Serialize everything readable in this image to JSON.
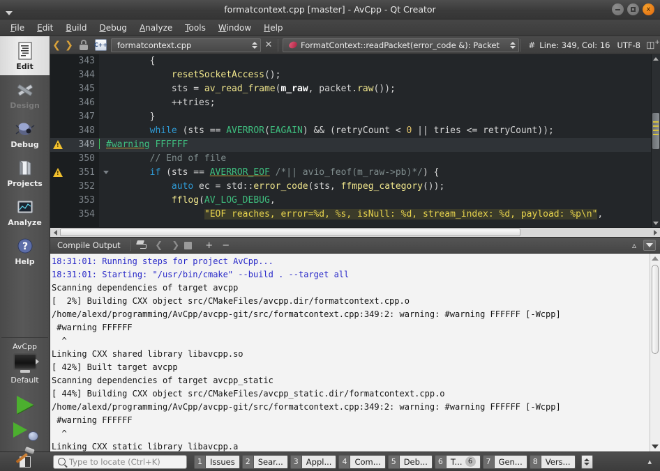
{
  "window": {
    "title": "formatcontext.cpp [master] - AvCpp - Qt Creator",
    "menu_arrow_icon": "triangle-down-icon",
    "buttons": {
      "minimize": "minimize-icon",
      "maximize": "maximize-icon",
      "close": "x"
    }
  },
  "menubar": {
    "items": [
      {
        "label": "File",
        "mnemonic": "F"
      },
      {
        "label": "Edit",
        "mnemonic": "E"
      },
      {
        "label": "Build",
        "mnemonic": "B"
      },
      {
        "label": "Debug",
        "mnemonic": "D"
      },
      {
        "label": "Analyze",
        "mnemonic": "A"
      },
      {
        "label": "Tools",
        "mnemonic": "T"
      },
      {
        "label": "Window",
        "mnemonic": "W"
      },
      {
        "label": "Help",
        "mnemonic": "H"
      }
    ]
  },
  "modebar": {
    "items": [
      {
        "label": "Edit",
        "icon": "document-lines-icon",
        "state": "active"
      },
      {
        "label": "Design",
        "icon": "ruler-pen-icon",
        "state": "disabled"
      },
      {
        "label": "Debug",
        "icon": "bug-icon",
        "state": "normal"
      },
      {
        "label": "Projects",
        "icon": "folder-icon",
        "state": "normal"
      },
      {
        "label": "Analyze",
        "icon": "monitor-graph-icon",
        "state": "normal"
      },
      {
        "label": "Help",
        "icon": "question-circle-icon",
        "state": "normal"
      }
    ],
    "kit": {
      "project": "AvCpp",
      "configuration": "Default",
      "target_icon": "desktop-monitor-icon",
      "expand_icon": "triangle-right-icon"
    },
    "actions": [
      {
        "name": "run",
        "icon": "play-icon"
      },
      {
        "name": "start-debugging",
        "icon": "play-bug-icon"
      },
      {
        "name": "build",
        "icon": "hammer-icon"
      }
    ]
  },
  "editor_toolbar": {
    "back_icon": "chevron-left-icon",
    "forward_icon": "chevron-right-icon",
    "lock_icon": "unlock-icon",
    "file_type_icon": "cpp-file-icon",
    "file_combo": "formatcontext.cpp",
    "close_icon": "close-x-icon",
    "symbol_icon": "symbol-method-icon",
    "symbol_combo": "FormatContext::readPacket(error_code &): Packet",
    "hash_icon": "line-number-icon",
    "line_col": "Line: 349, Col: 16",
    "encoding": "UTF-8",
    "split_icon": "split-editor-icon"
  },
  "editor": {
    "first_line": 343,
    "current_line": 349,
    "lines": [
      {
        "n": 343,
        "warn": false,
        "fold": false,
        "segments": [
          {
            "t": "        {",
            "c": "plain"
          }
        ]
      },
      {
        "n": 344,
        "warn": false,
        "fold": false,
        "segments": [
          {
            "t": "            ",
            "c": "plain"
          },
          {
            "t": "resetSocketAccess",
            "c": "fn"
          },
          {
            "t": "();",
            "c": "plain"
          }
        ]
      },
      {
        "n": 345,
        "warn": false,
        "fold": false,
        "segments": [
          {
            "t": "            sts = ",
            "c": "plain"
          },
          {
            "t": "av_read_frame",
            "c": "fn"
          },
          {
            "t": "(",
            "c": "plain"
          },
          {
            "t": "m_raw",
            "c": "var"
          },
          {
            "t": ", packet.",
            "c": "plain"
          },
          {
            "t": "raw",
            "c": "fn"
          },
          {
            "t": "());",
            "c": "plain"
          }
        ]
      },
      {
        "n": 346,
        "warn": false,
        "fold": false,
        "segments": [
          {
            "t": "            ++tries;",
            "c": "plain"
          }
        ]
      },
      {
        "n": 347,
        "warn": false,
        "fold": false,
        "segments": [
          {
            "t": "        }",
            "c": "plain"
          }
        ]
      },
      {
        "n": 348,
        "warn": false,
        "fold": false,
        "segments": [
          {
            "t": "        ",
            "c": "plain"
          },
          {
            "t": "while",
            "c": "kw"
          },
          {
            "t": " (sts == ",
            "c": "plain"
          },
          {
            "t": "AVERROR",
            "c": "typ"
          },
          {
            "t": "(",
            "c": "plain"
          },
          {
            "t": "EAGAIN",
            "c": "typ"
          },
          {
            "t": ") && (retryCount < ",
            "c": "plain"
          },
          {
            "t": "0",
            "c": "num"
          },
          {
            "t": " || tries <= retryCount));",
            "c": "plain"
          }
        ]
      },
      {
        "n": 349,
        "warn": true,
        "fold": false,
        "current": true,
        "segments": [
          {
            "t": "#warning",
            "c": "pp"
          },
          {
            "t": " FFFFFF",
            "c": "typ"
          }
        ]
      },
      {
        "n": 350,
        "warn": false,
        "fold": false,
        "segments": [
          {
            "t": "        // End of file",
            "c": "cmt"
          }
        ]
      },
      {
        "n": 351,
        "warn": true,
        "fold": true,
        "segments": [
          {
            "t": "        ",
            "c": "plain"
          },
          {
            "t": "if",
            "c": "kw"
          },
          {
            "t": " (sts == ",
            "c": "plain"
          },
          {
            "t": "AVERROR_EOF",
            "c": "ul-typ"
          },
          {
            "t": " ",
            "c": "plain"
          },
          {
            "t": "/*|| avio_feof(m_raw->pb)*/",
            "c": "cmt"
          },
          {
            "t": ") {",
            "c": "plain"
          }
        ]
      },
      {
        "n": 352,
        "warn": false,
        "fold": false,
        "segments": [
          {
            "t": "            ",
            "c": "plain"
          },
          {
            "t": "auto",
            "c": "kw"
          },
          {
            "t": " ec = std::",
            "c": "plain"
          },
          {
            "t": "error_code",
            "c": "fn"
          },
          {
            "t": "(sts, ",
            "c": "plain"
          },
          {
            "t": "ffmpeg_category",
            "c": "fn"
          },
          {
            "t": "());",
            "c": "plain"
          }
        ]
      },
      {
        "n": 353,
        "warn": false,
        "fold": false,
        "segments": [
          {
            "t": "            ",
            "c": "plain"
          },
          {
            "t": "fflog",
            "c": "fn"
          },
          {
            "t": "(",
            "c": "plain"
          },
          {
            "t": "AV_LOG_DEBUG",
            "c": "typ"
          },
          {
            "t": ",",
            "c": "plain"
          }
        ]
      },
      {
        "n": 354,
        "warn": false,
        "fold": false,
        "segments": [
          {
            "t": "                  ",
            "c": "plain"
          },
          {
            "t": "\"EOF reaches, error=%d, %s, isNull: %d, stream_index: %d, payload: %p\\n\"",
            "c": "str-hl"
          },
          {
            "t": ",",
            "c": "plain"
          }
        ]
      }
    ]
  },
  "output_pane": {
    "title": "Compile Output",
    "toolbar": [
      {
        "name": "clear",
        "icon": "broom-icon"
      },
      {
        "name": "previous-item",
        "icon": "chevron-left-icon"
      },
      {
        "name": "next-item",
        "icon": "chevron-right-icon"
      },
      {
        "name": "stop",
        "icon": "stop-square-icon"
      },
      {
        "name": "zoom-in",
        "icon": "plus-icon"
      },
      {
        "name": "zoom-out",
        "icon": "minus-icon"
      }
    ],
    "minimize_icon": "chevron-up-icon",
    "maximize_icon": "maximize-output-icon",
    "lines": [
      {
        "text": "18:31:01: Running steps for project AvCpp...",
        "style": "ts"
      },
      {
        "text": "18:31:01: Starting: \"/usr/bin/cmake\" --build . --target all",
        "style": "ts"
      },
      {
        "text": "Scanning dependencies of target avcpp",
        "style": "normal"
      },
      {
        "text": "[  2%] Building CXX object src/CMakeFiles/avcpp.dir/formatcontext.cpp.o",
        "style": "normal"
      },
      {
        "text": "/home/alexd/programming/AvCpp/avcpp-git/src/formatcontext.cpp:349:2: warning: #warning FFFFFF [-Wcpp]",
        "style": "normal"
      },
      {
        "text": " #warning FFFFFF",
        "style": "normal"
      },
      {
        "text": "  ^",
        "style": "normal"
      },
      {
        "text": "Linking CXX shared library libavcpp.so",
        "style": "normal"
      },
      {
        "text": "[ 42%] Built target avcpp",
        "style": "normal"
      },
      {
        "text": "Scanning dependencies of target avcpp_static",
        "style": "normal"
      },
      {
        "text": "[ 44%] Building CXX object src/CMakeFiles/avcpp_static.dir/formatcontext.cpp.o",
        "style": "normal"
      },
      {
        "text": "/home/alexd/programming/AvCpp/avcpp-git/src/formatcontext.cpp:349:2: warning: #warning FFFFFF [-Wcpp]",
        "style": "normal"
      },
      {
        "text": " #warning FFFFFF",
        "style": "normal"
      },
      {
        "text": "  ^",
        "style": "normal"
      },
      {
        "text": "Linking CXX static library libavcpp.a",
        "style": "normal"
      }
    ]
  },
  "statusbar": {
    "sidebar_toggle_icon": "toggle-sidebar-icon",
    "locator": {
      "icon": "search-icon",
      "placeholder": "Type to locate (Ctrl+K)",
      "value": ""
    },
    "tabs": [
      {
        "n": "1",
        "label": "Issues",
        "badge": ""
      },
      {
        "n": "2",
        "label": "Sear...",
        "badge": ""
      },
      {
        "n": "3",
        "label": "Appl...",
        "badge": ""
      },
      {
        "n": "4",
        "label": "Com...",
        "badge": ""
      },
      {
        "n": "5",
        "label": "Deb...",
        "badge": ""
      },
      {
        "n": "6",
        "label": "T...",
        "badge": "6"
      },
      {
        "n": "7",
        "label": "Gen...",
        "badge": ""
      },
      {
        "n": "8",
        "label": "Vers...",
        "badge": ""
      }
    ],
    "spin_icon": "updown-spinner-icon",
    "progress_chev_icon": "chevron-up-icon"
  },
  "colors": {
    "accent_orange": "#e0660d",
    "warning_yellow": "#f2c12e",
    "timestamp_blue": "#2828c8",
    "run_green": "#4caf2f",
    "editor_bg": "#232629",
    "output_bg": "#f3f3f3"
  }
}
